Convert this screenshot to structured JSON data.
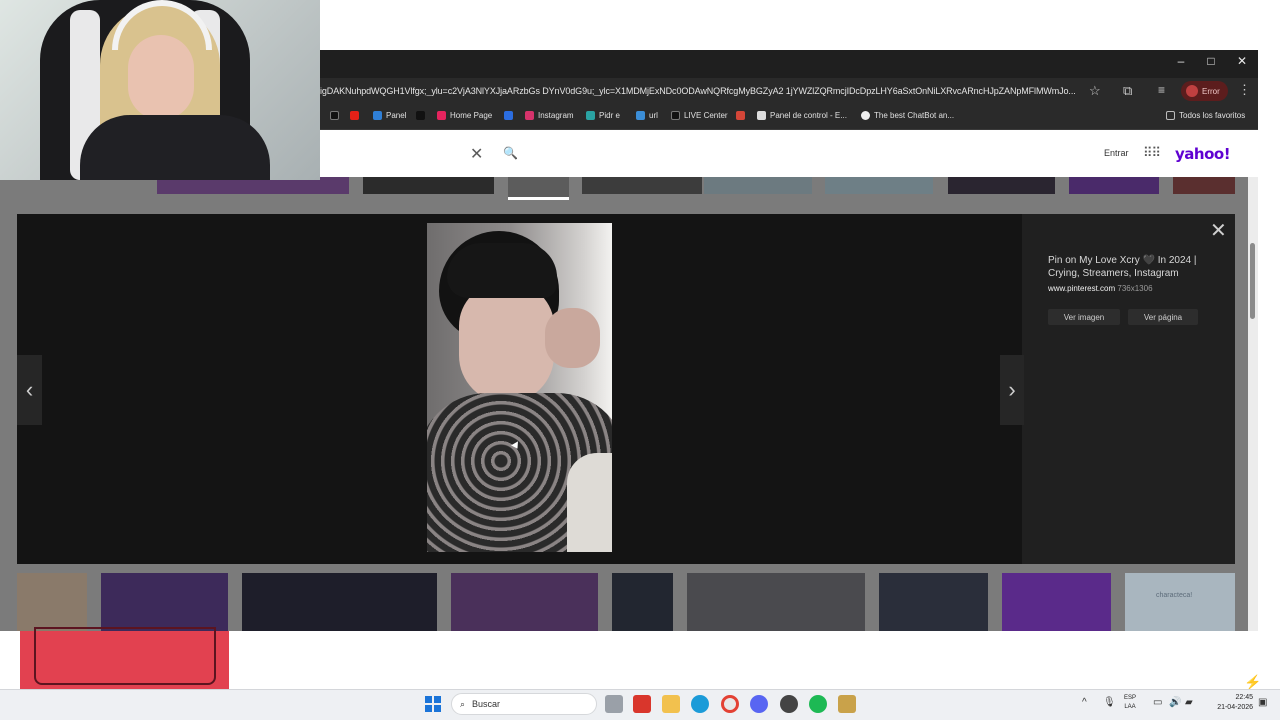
{
  "browser": {
    "url": "igDAKNuhpdWQGH1Vlfgx;_ylu=c2VjA3NlYXJjaARzbGs DYnV0dG9u;_ylc=X1MDMjExNDc0ODAwNQRfcgMyBGZyA2 1jYWZlZQRmcjIDcDpzLHY6aSxtOnNiLXRvcARncHJpZANpMFlMWmJo...",
    "profile_label": "Error",
    "bookmarks": [
      "Panel",
      "Home Page",
      "Instagram",
      "Pidr e",
      "url",
      "LIVE Center",
      "Panel de control - E...",
      "The best ChatBot an...",
      "Todos los favoritos"
    ],
    "window_controls": {
      "minimize": "–",
      "maximize": "□",
      "close": "✕"
    }
  },
  "yahoo": {
    "signin": "Entrar",
    "logo": "yahoo!",
    "clear_glyph": "✕",
    "search_glyph": "🔍"
  },
  "lightbox": {
    "title": "Pin on My Love Xcry 🖤 In 2024 | Crying, Streamers, Instagram",
    "domain": "www.pinterest.com",
    "dimensions": "736x1306",
    "view_image_label": "Ver imagen",
    "view_page_label": "Ver página",
    "close_glyph": "✕",
    "prev_glyph": "‹",
    "next_glyph": "›"
  },
  "thumbnails": {
    "last_label": "characteca!"
  },
  "taskbar": {
    "search_label": "Buscar",
    "lang_top": "ESP",
    "lang_bottom": "LAA",
    "time": "22:45",
    "date": "21-04-2026",
    "tray_up": "^"
  },
  "colors": {
    "yahoo_purple": "#5f01d1",
    "profile_error": "#5c1d1d",
    "lightbox_bg": "#141414"
  }
}
